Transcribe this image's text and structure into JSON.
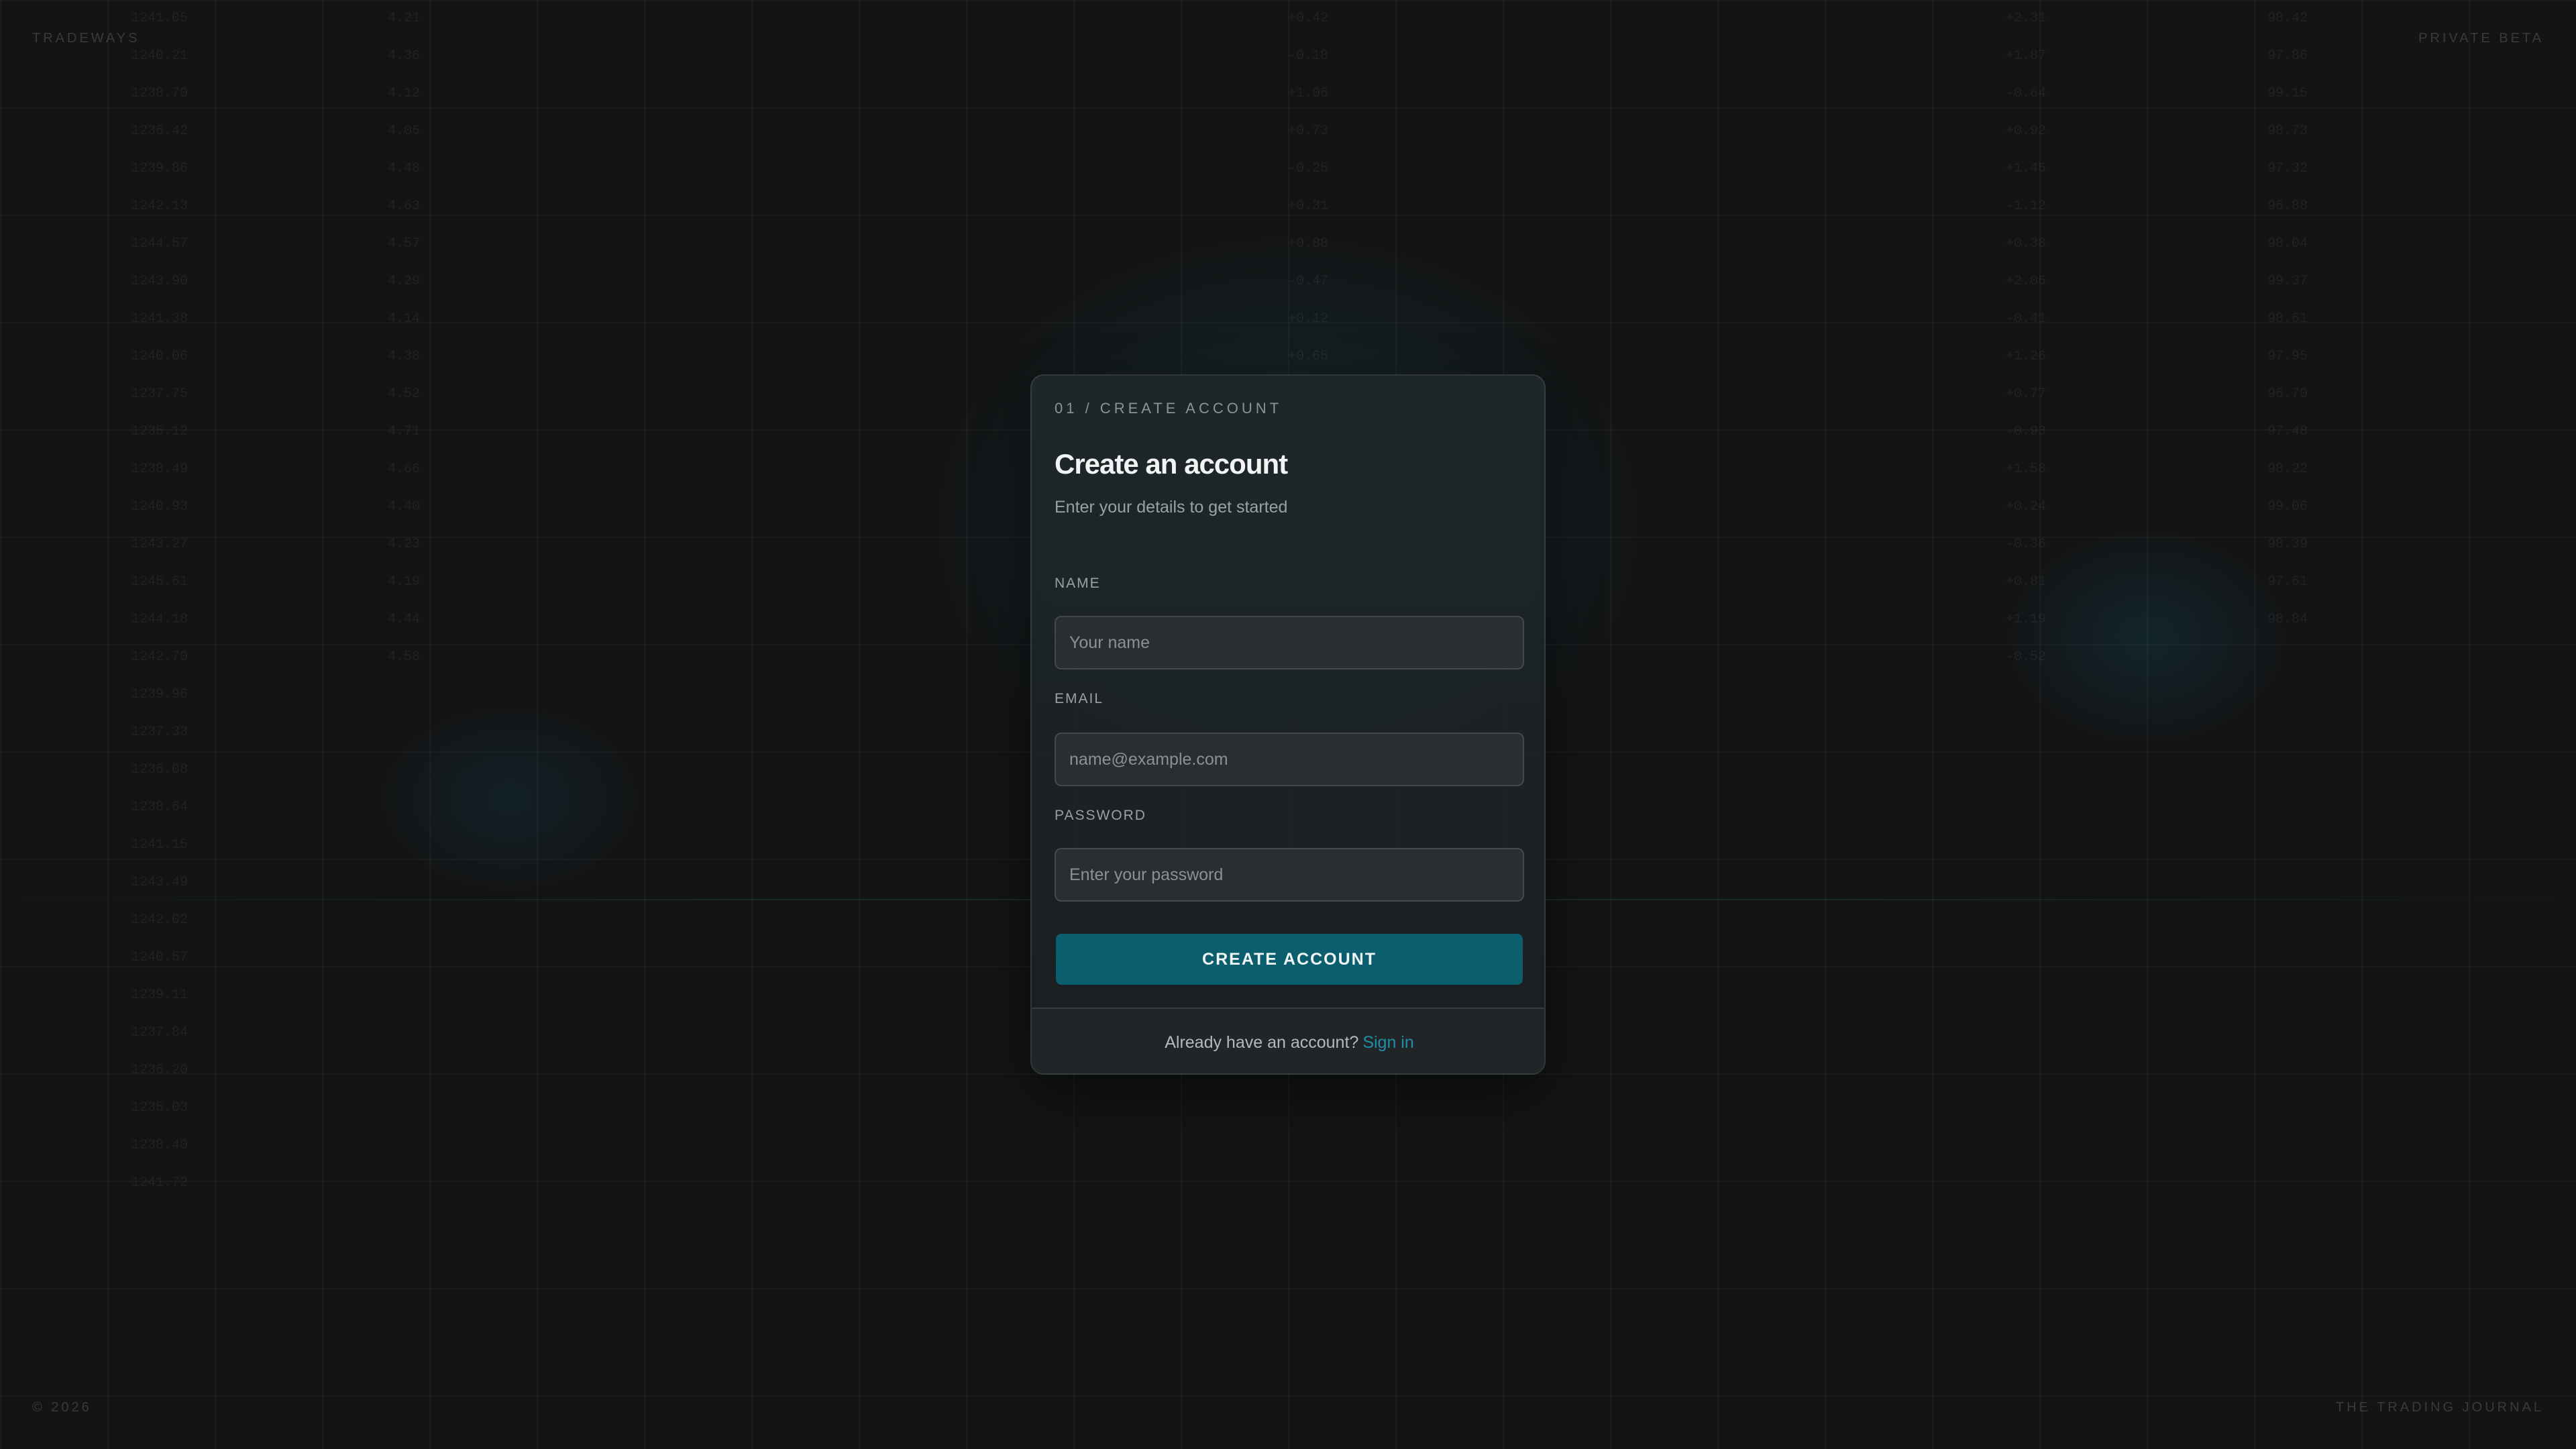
{
  "corners": {
    "brand": "TRADEWAYS",
    "badge": "PRIVATE BETA",
    "copyright": "© 2026",
    "tagline": "THE TRADING JOURNAL"
  },
  "form": {
    "step": "01 / CREATE ACCOUNT",
    "title": "Create an account",
    "subtitle": "Enter your details to get started",
    "fields": {
      "name": {
        "label": "NAME",
        "placeholder": "Your name",
        "value": ""
      },
      "email": {
        "label": "EMAIL",
        "placeholder": "name@example.com",
        "value": ""
      },
      "password": {
        "label": "PASSWORD",
        "placeholder": "Enter your password",
        "value": ""
      }
    },
    "submit_label": "CREATE ACCOUNT",
    "footer_text": "Already have an account?",
    "signin_label": "Sign in"
  },
  "colors": {
    "accent": "#0b5e6e",
    "link": "#1f8fa8",
    "background": "#131415"
  }
}
